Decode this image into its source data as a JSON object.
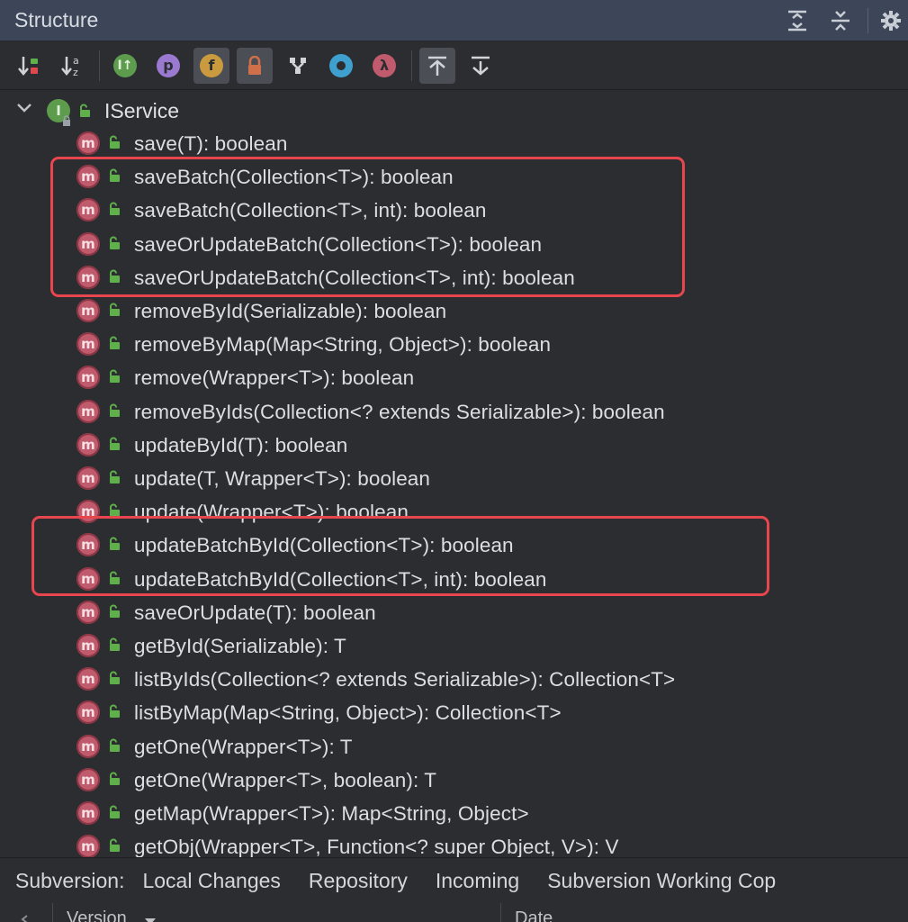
{
  "panel": {
    "title": "Structure"
  },
  "colors": {
    "header_bg": "#3c4658",
    "background": "#2b2d30",
    "method_icon": "#c05a6d",
    "interface_icon": "#5d9c4d",
    "highlight_border": "#e8464f"
  },
  "toolbar": {
    "buttons": [
      {
        "icon": "sort-by-visibility-icon",
        "active": false
      },
      {
        "icon": "sort-alphabetically-icon",
        "active": false
      },
      {
        "icon": "show-inherited-icon",
        "active": false
      },
      {
        "icon": "show-properties-icon",
        "glyph": "p",
        "active": false
      },
      {
        "icon": "show-fields-icon",
        "glyph": "f",
        "active": true
      },
      {
        "icon": "show-non-public-icon",
        "active": true
      },
      {
        "icon": "group-methods-icon",
        "active": false
      },
      {
        "icon": "show-anonymous-icon",
        "active": false
      },
      {
        "icon": "show-lambdas-icon",
        "glyph": "λ",
        "active": false
      },
      {
        "icon": "autoscroll-to-source-icon",
        "active": true
      },
      {
        "icon": "autoscroll-from-source-icon",
        "active": false
      }
    ]
  },
  "tree": {
    "root": {
      "label": "IService",
      "icon_letter": "I",
      "expanded": true
    },
    "method_icon_letter": "m",
    "methods": [
      {
        "label": "save(T): boolean"
      },
      {
        "label": "saveBatch(Collection<T>): boolean"
      },
      {
        "label": "saveBatch(Collection<T>, int): boolean"
      },
      {
        "label": "saveOrUpdateBatch(Collection<T>): boolean"
      },
      {
        "label": "saveOrUpdateBatch(Collection<T>, int): boolean"
      },
      {
        "label": "removeById(Serializable): boolean"
      },
      {
        "label": "removeByMap(Map<String, Object>): boolean"
      },
      {
        "label": "remove(Wrapper<T>): boolean"
      },
      {
        "label": "removeByIds(Collection<? extends Serializable>): boolean"
      },
      {
        "label": "updateById(T): boolean"
      },
      {
        "label": "update(T, Wrapper<T>): boolean"
      },
      {
        "label": "update(Wrapper<T>): boolean"
      },
      {
        "label": "updateBatchById(Collection<T>): boolean"
      },
      {
        "label": "updateBatchById(Collection<T>, int): boolean"
      },
      {
        "label": "saveOrUpdate(T): boolean"
      },
      {
        "label": "getById(Serializable): T"
      },
      {
        "label": "listByIds(Collection<? extends Serializable>): Collection<T>"
      },
      {
        "label": "listByMap(Map<String, Object>): Collection<T>"
      },
      {
        "label": "getOne(Wrapper<T>): T"
      },
      {
        "label": "getOne(Wrapper<T>, boolean): T"
      },
      {
        "label": "getMap(Wrapper<T>): Map<String, Object>"
      },
      {
        "label": "getObj(Wrapper<T>, Function<? super Object, V>): V"
      }
    ]
  },
  "bottom_bar": {
    "prefix": "Subversion:",
    "tabs": [
      "Local Changes",
      "Repository",
      "Incoming",
      "Subversion Working Cop"
    ]
  },
  "table_header": {
    "columns": [
      "Version",
      "Date"
    ]
  }
}
